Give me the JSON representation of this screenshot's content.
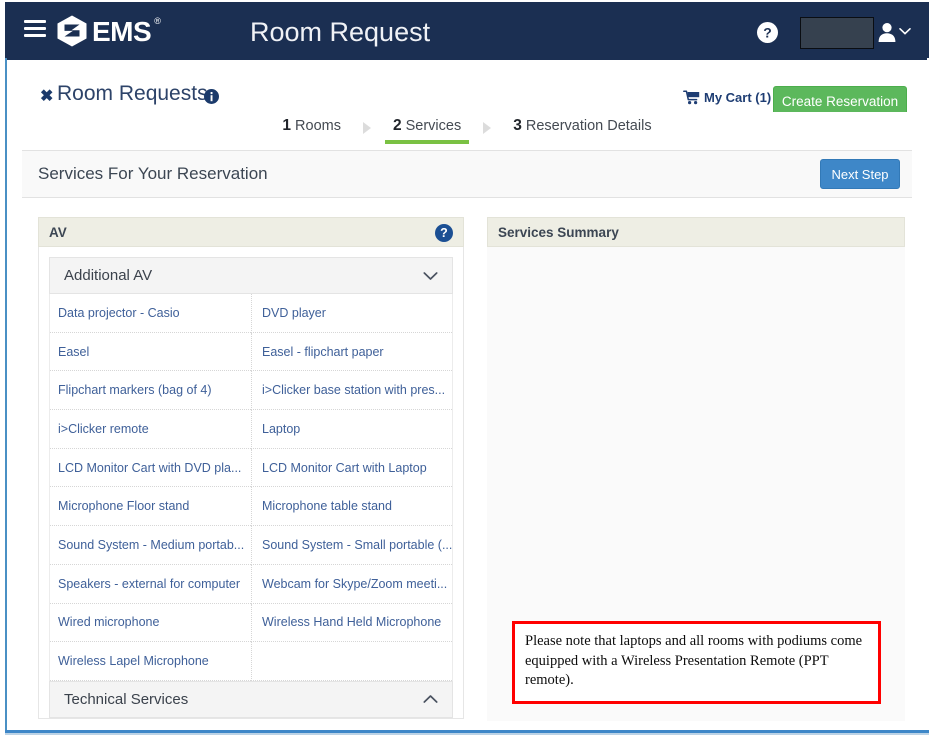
{
  "topbar": {
    "menu_icon": "hamburger-icon",
    "logo_text": "EMS",
    "logo_tm": "®",
    "app_title": "Room Request",
    "help_icon": "question-circle-icon",
    "user_icon": "user-icon",
    "user_caret_icon": "chevron-down-icon",
    "user_name": ""
  },
  "pagehead": {
    "close_label": "✖",
    "title": "Room Requests",
    "info_icon": "info-circle-icon",
    "cart_icon": "shopping-cart-icon",
    "cart_label": "My Cart (1)",
    "create_reservation_label": "Create Reservation"
  },
  "steps": [
    {
      "num": "1",
      "label": "Rooms",
      "active": false
    },
    {
      "num": "2",
      "label": "Services",
      "active": true
    },
    {
      "num": "3",
      "label": "Reservation Details",
      "active": false
    }
  ],
  "subhead": {
    "title": "Services For Your Reservation",
    "next_step_label": "Next Step"
  },
  "av_panel": {
    "header": "AV",
    "help_icon": "question-circle-icon",
    "accordions": [
      {
        "label": "Additional AV",
        "expanded": true,
        "chevron": "chevron-down-icon"
      },
      {
        "label": "Technical Services",
        "expanded": false,
        "chevron": "chevron-up-icon"
      }
    ],
    "items": [
      [
        "Data projector - Casio",
        "DVD player"
      ],
      [
        "Easel",
        "Easel - flipchart paper"
      ],
      [
        "Flipchart markers (bag of 4)",
        "i>Clicker base station with pres..."
      ],
      [
        "i>Clicker remote",
        "Laptop"
      ],
      [
        "LCD Monitor Cart with DVD pla...",
        "LCD Monitor Cart with Laptop"
      ],
      [
        "Microphone Floor stand",
        "Microphone table stand"
      ],
      [
        "Sound System - Medium portab...",
        "Sound System - Small portable (..."
      ],
      [
        "Speakers - external for computer",
        "Webcam for Skype/Zoom meeti..."
      ],
      [
        "Wired microphone",
        "Wireless Hand Held Microphone"
      ],
      [
        "Wireless Lapel Microphone",
        ""
      ]
    ]
  },
  "summary_panel": {
    "header": "Services Summary",
    "note": "Please note that laptops and all rooms with podiums come equipped with a Wireless Presentation Remote (PPT remote)."
  },
  "colors": {
    "navy": "#1b2f52",
    "green_accent": "#7ac143",
    "create_green": "#5cb85c",
    "next_blue": "#3e87c8",
    "link_blue": "#3f6099",
    "panel_head_beige": "#eeeee4",
    "note_border_red": "#ff0000",
    "frame_blue": "#4a90c4"
  }
}
